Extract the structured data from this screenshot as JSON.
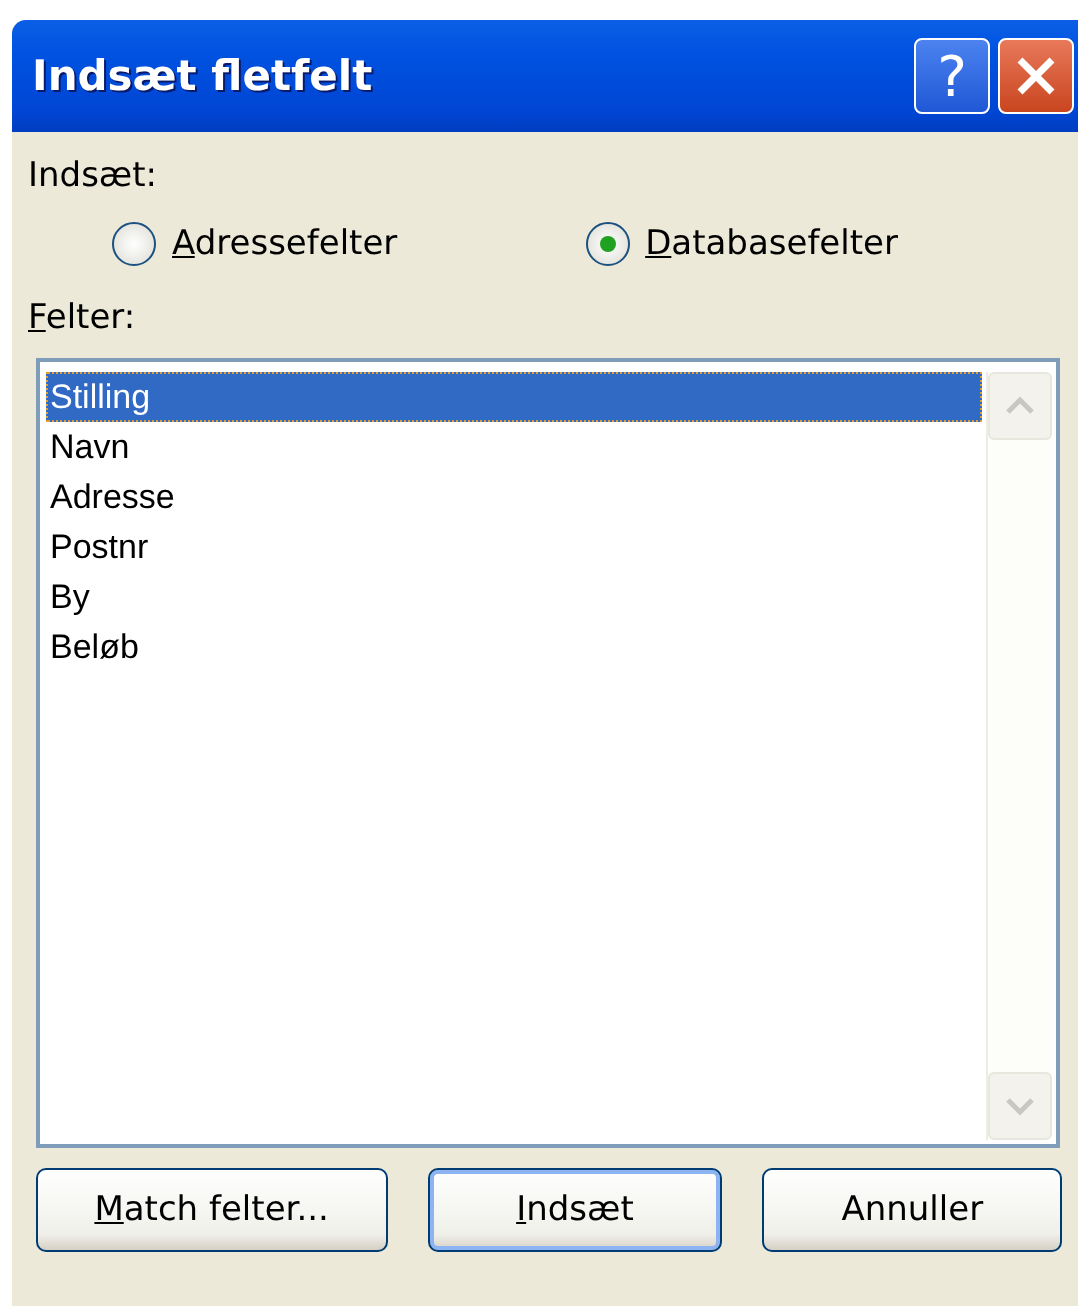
{
  "window": {
    "title": "Indsæt fletfelt",
    "title_buttons": [
      {
        "kind": "help",
        "label": "?"
      },
      {
        "kind": "close"
      }
    ]
  },
  "insert_group": {
    "label": "Indsæt:",
    "options": [
      {
        "label": "Adressefelter",
        "first_letter_underlined": true,
        "selected": false
      },
      {
        "label": "Databasefelter",
        "first_letter_underlined": true,
        "selected": true
      }
    ]
  },
  "fields": {
    "label": "Felter:",
    "first_letter_underlined": true,
    "items": [
      {
        "label": "Stilling",
        "selected": true
      },
      {
        "label": "Navn",
        "selected": false
      },
      {
        "label": "Adresse",
        "selected": false
      },
      {
        "label": "Postnr",
        "selected": false
      },
      {
        "label": "By",
        "selected": false
      },
      {
        "label": "Beløb",
        "selected": false
      }
    ]
  },
  "buttons": [
    {
      "label": "Match felter...",
      "first_letter_underlined": true,
      "default": false
    },
    {
      "label": "Indsæt",
      "first_letter_underlined": true,
      "default": true
    },
    {
      "label": "Annuller",
      "first_letter_underlined": false,
      "default": false
    }
  ]
}
